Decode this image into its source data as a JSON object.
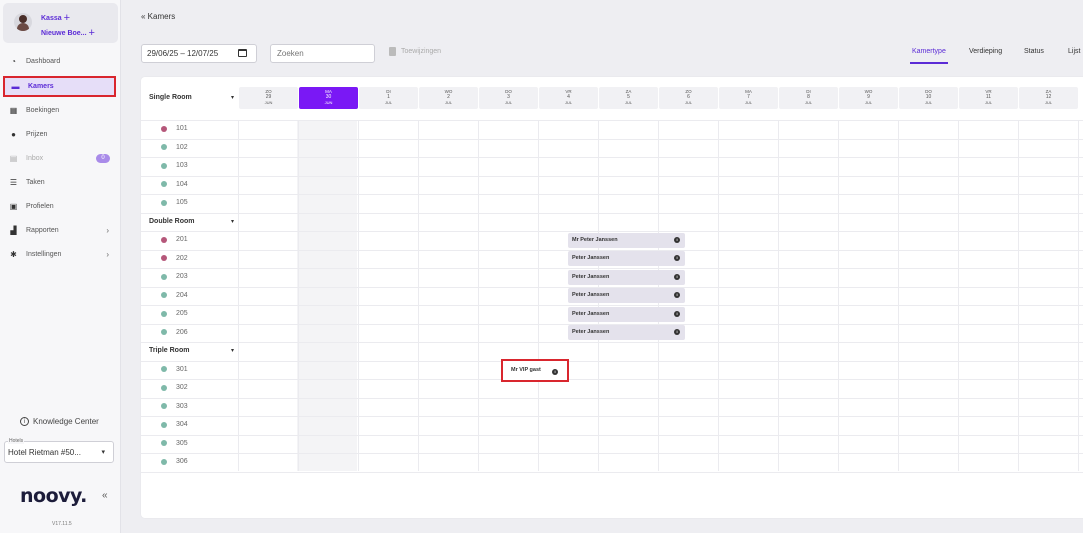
{
  "user": {
    "line1": "Kassa",
    "line2": "Nieuwe Boe..."
  },
  "nav": [
    {
      "label": "Dashboard"
    },
    {
      "label": "Kamers"
    },
    {
      "label": "Boekingen"
    },
    {
      "label": "Prijzen"
    },
    {
      "label": "Inbox",
      "badge": "0"
    },
    {
      "label": "Taken"
    },
    {
      "label": "Profielen"
    },
    {
      "label": "Rapporten"
    },
    {
      "label": "Instellingen"
    }
  ],
  "knowledge_center": "Knowledge Center",
  "hotel": {
    "label": "Hotels",
    "value": "Hotel Rietman #50..."
  },
  "logo": "noovy.",
  "version": "V17.11.5",
  "breadcrumb": "« Kamers",
  "date_range": "29/06/25 – 12/07/25",
  "search_placeholder": "Zoeken",
  "toewijzingen": "Toewijzingen",
  "view_tabs": [
    "Kamertype",
    "Verdieping",
    "Status",
    "Lijst"
  ],
  "days": [
    {
      "dn": "ZO",
      "dd": "29",
      "dm": "JUN"
    },
    {
      "dn": "MA",
      "dd": "30",
      "dm": "JUN",
      "today": true
    },
    {
      "dn": "DI",
      "dd": "1",
      "dm": "JUL"
    },
    {
      "dn": "WO",
      "dd": "2",
      "dm": "JUL"
    },
    {
      "dn": "DO",
      "dd": "3",
      "dm": "JUL"
    },
    {
      "dn": "VR",
      "dd": "4",
      "dm": "JUL"
    },
    {
      "dn": "ZA",
      "dd": "5",
      "dm": "JUL"
    },
    {
      "dn": "ZO",
      "dd": "6",
      "dm": "JUL"
    },
    {
      "dn": "MA",
      "dd": "7",
      "dm": "JUL"
    },
    {
      "dn": "DI",
      "dd": "8",
      "dm": "JUL"
    },
    {
      "dn": "WO",
      "dd": "9",
      "dm": "JUL"
    },
    {
      "dn": "DO",
      "dd": "10",
      "dm": "JUL"
    },
    {
      "dn": "VR",
      "dd": "11",
      "dm": "JUL"
    },
    {
      "dn": "ZA",
      "dd": "12",
      "dm": "JUL"
    }
  ],
  "categories": [
    {
      "name": "Single Room",
      "rooms": [
        {
          "num": "101",
          "status": "dirty"
        },
        {
          "num": "102",
          "status": "clean"
        },
        {
          "num": "103",
          "status": "clean"
        },
        {
          "num": "104",
          "status": "clean"
        },
        {
          "num": "105",
          "status": "clean"
        }
      ]
    },
    {
      "name": "Double Room",
      "rooms": [
        {
          "num": "201",
          "status": "dirty"
        },
        {
          "num": "202",
          "status": "dirty"
        },
        {
          "num": "203",
          "status": "clean"
        },
        {
          "num": "204",
          "status": "clean"
        },
        {
          "num": "205",
          "status": "clean"
        },
        {
          "num": "206",
          "status": "clean"
        }
      ]
    },
    {
      "name": "Triple Room",
      "rooms": [
        {
          "num": "301",
          "status": "clean"
        },
        {
          "num": "302",
          "status": "clean"
        },
        {
          "num": "303",
          "status": "clean"
        },
        {
          "num": "304",
          "status": "clean"
        },
        {
          "num": "305",
          "status": "clean"
        },
        {
          "num": "306",
          "status": "clean"
        }
      ]
    }
  ],
  "bookings": [
    {
      "room": "201",
      "guest": "Mr Peter Janssen"
    },
    {
      "room": "202",
      "guest": "Peter Janssen"
    },
    {
      "room": "203",
      "guest": "Peter Janssen"
    },
    {
      "room": "204",
      "guest": "Peter Janssen"
    },
    {
      "room": "205",
      "guest": "Peter Janssen"
    },
    {
      "room": "206",
      "guest": "Peter Janssen"
    },
    {
      "room": "301",
      "guest": "Mr VIP gast"
    }
  ],
  "colors": {
    "accent": "#5b2bd6",
    "today": "#7a18f5",
    "dirty": "#b5577a",
    "clean": "#7fb9a9",
    "highlight": "#d9262e"
  }
}
